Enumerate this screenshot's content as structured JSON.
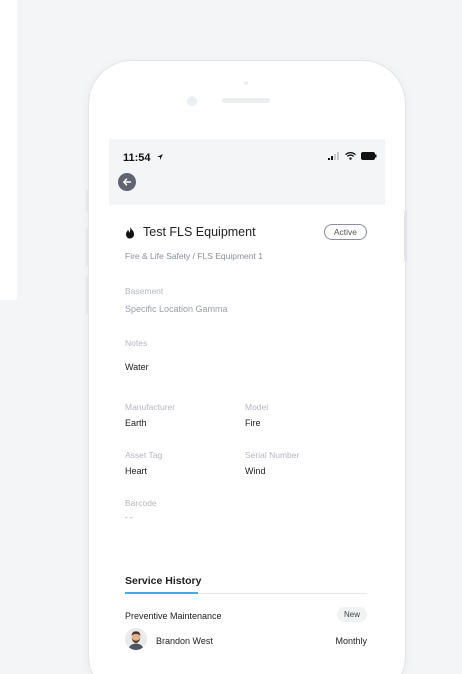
{
  "status_bar": {
    "time": "11:54"
  },
  "asset": {
    "title": "Test FLS Equipment",
    "status": "Active",
    "breadcrumb": "Fire & Life Safety / FLS Equipment 1",
    "location_label": "Basement",
    "location_value": "Specific Location Gamma",
    "notes_label": "Notes",
    "notes_value": "Water",
    "manufacturer_label": "Manufacturer",
    "manufacturer_value": "Earth",
    "model_label": "Model",
    "model_value": "Fire",
    "asset_tag_label": "Asset Tag",
    "asset_tag_value": "Heart",
    "serial_label": "Serial Number",
    "serial_value": "Wind",
    "barcode_label": "Barcode",
    "barcode_value": "- -"
  },
  "service_history": {
    "title": "Service History",
    "items": [
      {
        "type": "Preventive Maintenance",
        "badge": "New",
        "technician": "Brandon West",
        "frequency": "Monthly"
      }
    ]
  },
  "colors": {
    "accent": "#4aa7e0",
    "screen_bg": "#f4f5f7",
    "back_button": "#5f6470"
  }
}
